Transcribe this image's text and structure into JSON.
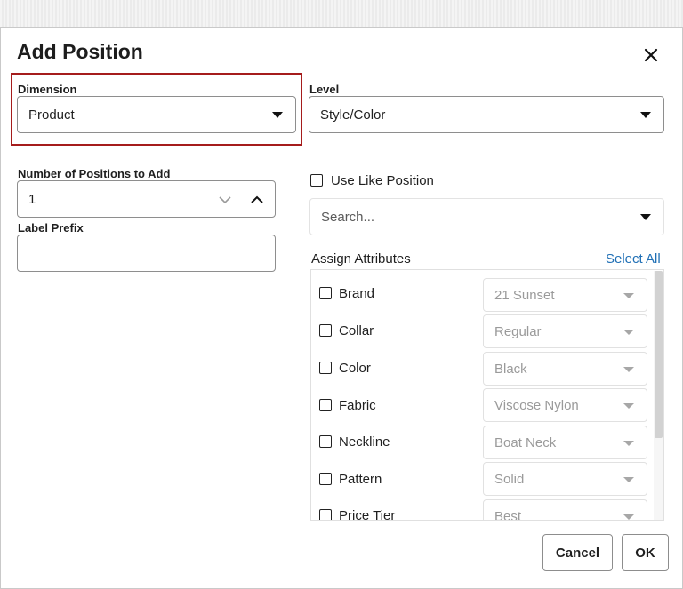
{
  "dialog": {
    "title": "Add Position"
  },
  "dimension": {
    "label": "Dimension",
    "value": "Product"
  },
  "level": {
    "label": "Level",
    "value": "Style/Color"
  },
  "positions": {
    "label": "Number of Positions to Add",
    "value": "1"
  },
  "label_prefix": {
    "label": "Label Prefix",
    "value": ""
  },
  "like_position": {
    "label": "Use Like Position",
    "checked": false
  },
  "search": {
    "placeholder": "Search..."
  },
  "attributes": {
    "title": "Assign Attributes",
    "select_all": "Select All",
    "items": [
      {
        "name": "Brand",
        "value": "21 Sunset"
      },
      {
        "name": "Collar",
        "value": "Regular"
      },
      {
        "name": "Color",
        "value": "Black"
      },
      {
        "name": "Fabric",
        "value": "Viscose Nylon"
      },
      {
        "name": "Neckline",
        "value": "Boat Neck"
      },
      {
        "name": "Pattern",
        "value": "Solid"
      },
      {
        "name": "Price Tier",
        "value": "Best"
      }
    ]
  },
  "footer": {
    "cancel_label": "Cancel",
    "ok_label": "OK"
  },
  "colors": {
    "highlight": "#a51c1c",
    "link": "#1f6fb5"
  },
  "icons": {
    "close": "close-icon",
    "dropdown": "caret-down-icon",
    "stepper_down": "chevron-down-icon",
    "stepper_up": "chevron-up-icon"
  }
}
